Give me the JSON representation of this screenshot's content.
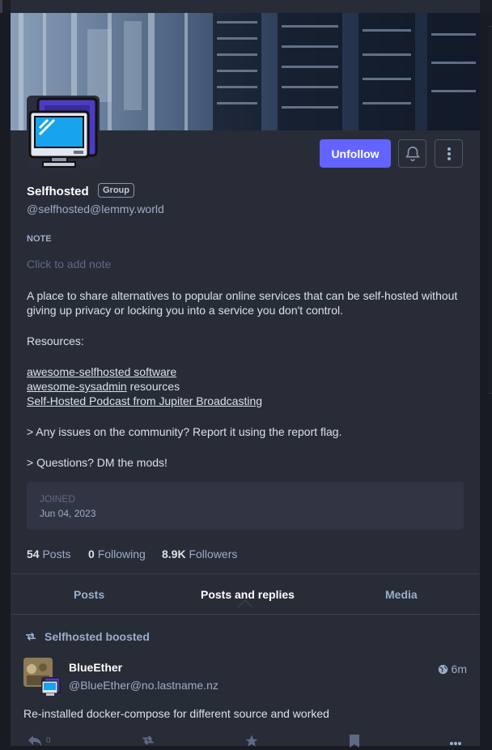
{
  "profile": {
    "name": "Selfhosted",
    "badge": "Group",
    "handle": "@selfhosted@lemmy.world",
    "unfollow_label": "Unfollow",
    "note_label": "NOTE",
    "note_placeholder": "Click to add note"
  },
  "bio": {
    "intro": "A place to share alternatives to popular online services that can be self-hosted without giving up privacy or locking you into a service you don't control.",
    "resources_label": "Resources:",
    "link1": "awesome-selfhosted software",
    "link2": "awesome-sysadmin",
    "link2_suffix": " resources",
    "link3": "Self-Hosted Podcast from Jupiter Broadcasting",
    "line_issues": "> Any issues on the community? Report it using the report flag.",
    "line_questions": "> Questions? DM the mods!"
  },
  "joined": {
    "label": "JOINED",
    "date": "Jun 04, 2023"
  },
  "counts": {
    "posts_value": "54",
    "posts_label": "Posts",
    "following_value": "0",
    "following_label": "Following",
    "followers_value": "8.9K",
    "followers_label": "Followers"
  },
  "tabs": [
    {
      "label": "Posts",
      "active": false
    },
    {
      "label": "Posts and replies",
      "active": true
    },
    {
      "label": "Media",
      "active": false
    }
  ],
  "post": {
    "boost_label": "Selfhosted boosted",
    "author": "BlueEther",
    "author_handle": "@BlueEther@no.lastname.nz",
    "time": "6m",
    "text": "Re-installed docker-compose for different source and worked",
    "reply_count": "0"
  },
  "icons": {
    "bell": "bell-icon",
    "more": "more-vertical-icon",
    "boost": "retweet-icon",
    "globe": "globe-icon",
    "reply": "reply-icon",
    "star": "star-icon",
    "bookmark": "bookmark-icon",
    "ellipsis": "ellipsis-icon"
  },
  "colors": {
    "accent": "#6364ff",
    "background": "#191b22",
    "column": "#282c37"
  }
}
